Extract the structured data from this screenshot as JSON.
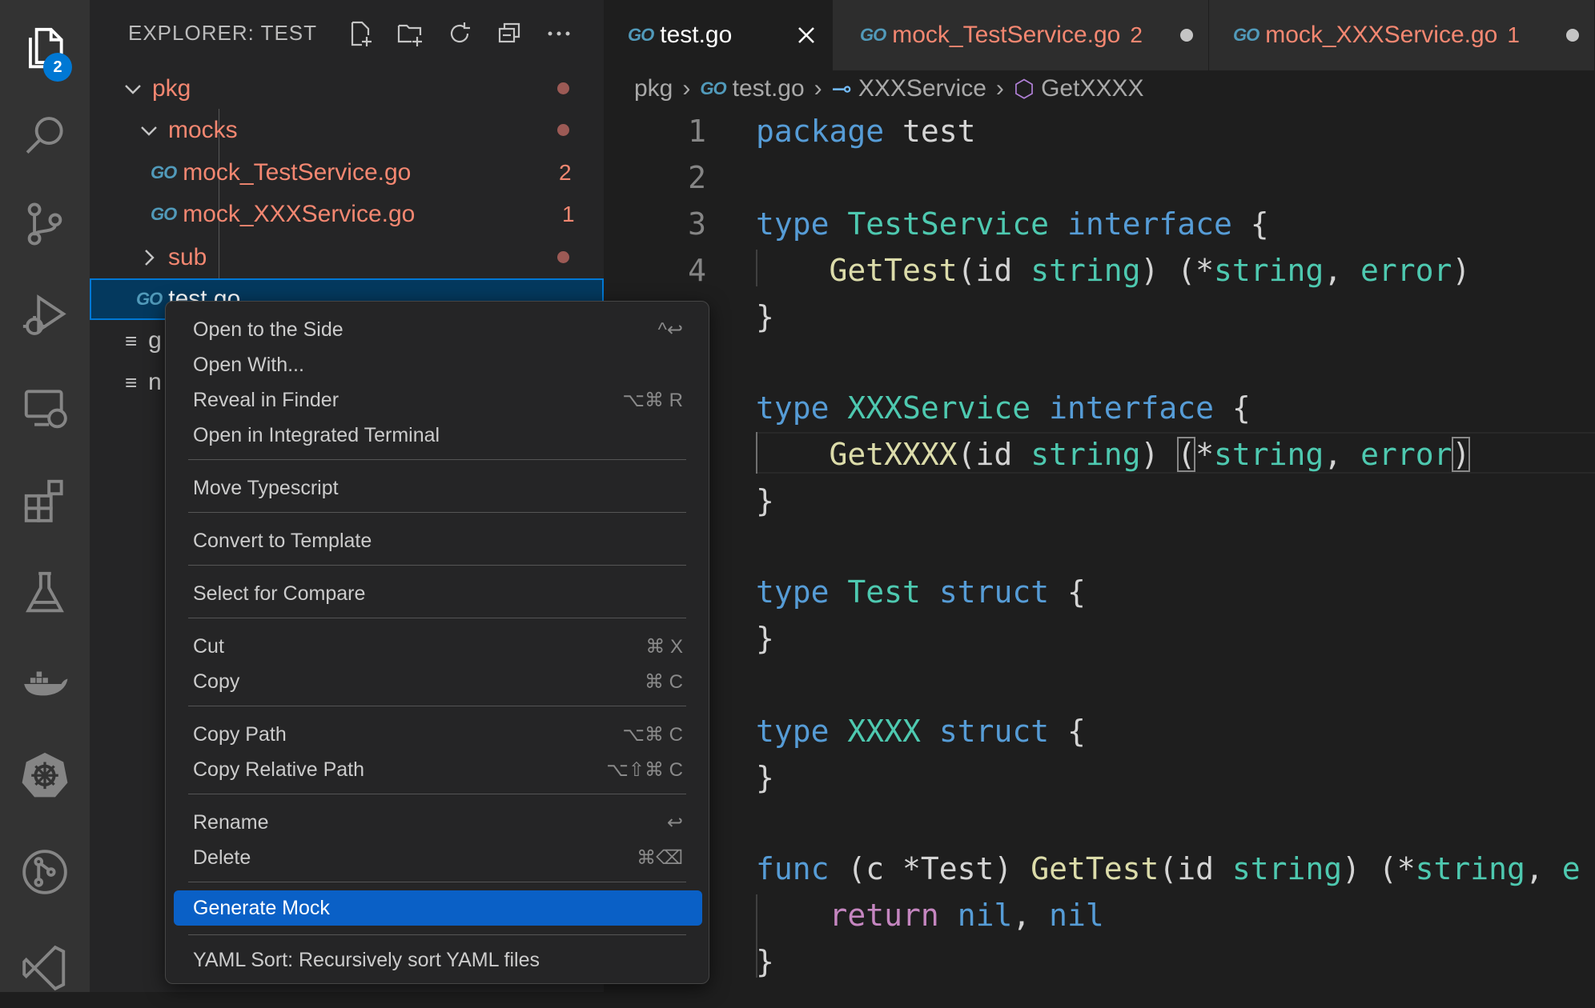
{
  "activity_bar": {
    "explorer_badge": "2",
    "icons": [
      "files-icon",
      "search-icon",
      "source-control-icon",
      "run-debug-icon",
      "remote-explorer-icon",
      "extensions-icon",
      "testing-icon",
      "docker-icon",
      "kubernetes-icon",
      "git-graph-icon",
      "vscode-logo-icon"
    ]
  },
  "sidebar": {
    "title": "EXPLORER: TEST",
    "tree": {
      "pkg": "pkg",
      "mocks": "mocks",
      "mock_test": "mock_TestService.go",
      "mock_test_count": "2",
      "mock_xxx": "mock_XXXService.go",
      "mock_xxx_count": "1",
      "sub": "sub",
      "test_go": "test.go",
      "file_g": "g",
      "file_n": "n"
    },
    "go_icon_text": "GO"
  },
  "tabs": [
    {
      "label": "test.go"
    },
    {
      "label": "mock_TestService.go",
      "count": "2"
    },
    {
      "label": "mock_XXXService.go",
      "count": "1"
    }
  ],
  "breadcrumb": {
    "pkg": "pkg",
    "file": "test.go",
    "iface": "XXXService",
    "method": "GetXXXX"
  },
  "editor": {
    "line_numbers": [
      "1",
      "2",
      "3",
      "4"
    ],
    "tokens": {
      "package": "package",
      "test": "test",
      "type": "type",
      "interface": "interface",
      "struct": "struct",
      "func": "func",
      "return": "return",
      "nil": "nil",
      "string": "string",
      "error": "error",
      "TestService": "TestService",
      "XXXService": "XXXService",
      "Test": "Test",
      "XXXX": "XXXX",
      "GetTest": "GetTest",
      "GetXXXX": "GetXXXX",
      "open_brace": "{",
      "close_brace": "}",
      "params": "(id ",
      "rparen": ") ",
      "star": "(*",
      "comma": ", ",
      "close_paren": ")",
      "receiver": " (c *Test) ",
      "err_trunc": "e"
    }
  },
  "context_menu": {
    "items": [
      {
        "label": "Open to the Side",
        "shortcut": "^↩"
      },
      {
        "label": "Open With...",
        "shortcut": ""
      },
      {
        "label": "Reveal in Finder",
        "shortcut": "⌥⌘ R"
      },
      {
        "label": "Open in Integrated Terminal",
        "shortcut": ""
      },
      {
        "label": "Move Typescript",
        "shortcut": ""
      },
      {
        "label": "Convert to Template",
        "shortcut": ""
      },
      {
        "label": "Select for Compare",
        "shortcut": ""
      },
      {
        "label": "Cut",
        "shortcut": "⌘ X"
      },
      {
        "label": "Copy",
        "shortcut": "⌘ C"
      },
      {
        "label": "Copy Path",
        "shortcut": "⌥⌘ C"
      },
      {
        "label": "Copy Relative Path",
        "shortcut": "⌥⇧⌘ C"
      },
      {
        "label": "Rename",
        "shortcut": "↩"
      },
      {
        "label": "Delete",
        "shortcut": "⌘⌫"
      },
      {
        "label": "Generate Mock",
        "shortcut": ""
      },
      {
        "label": "YAML Sort: Recursively sort YAML files",
        "shortcut": ""
      }
    ]
  },
  "colors": {
    "accent": "#0078d4",
    "highlight": "#0a60c6",
    "modified": "#f48771"
  }
}
